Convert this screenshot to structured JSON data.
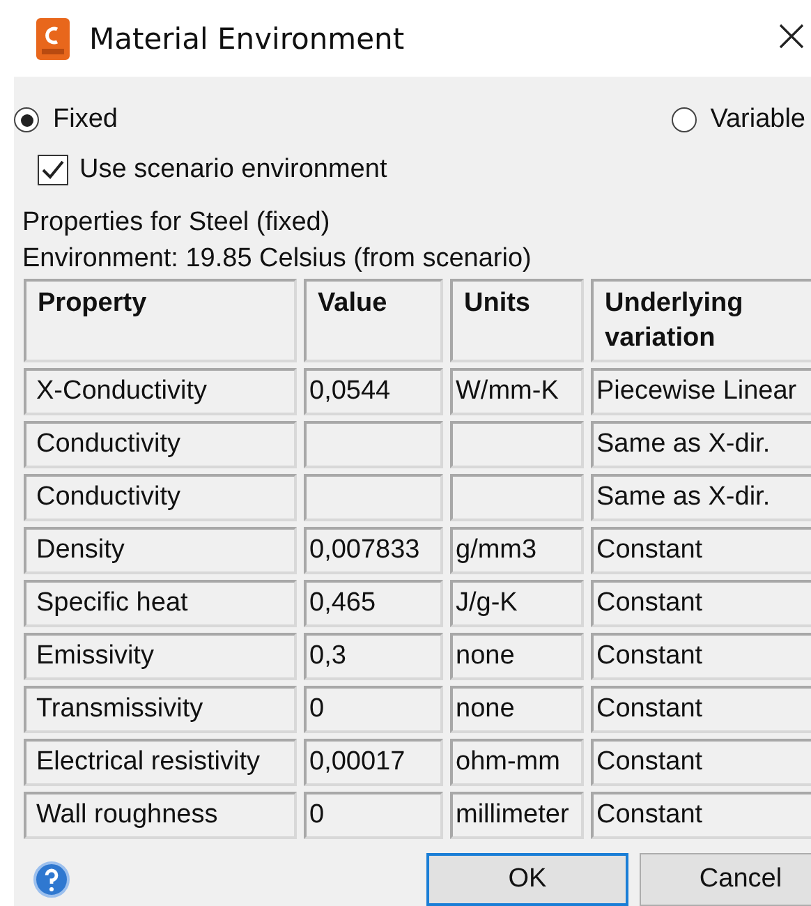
{
  "window": {
    "title": "Material Environment"
  },
  "modes": [
    {
      "label": "Fixed",
      "selected": true
    },
    {
      "label": "Variable",
      "selected": false
    }
  ],
  "scenario_checkbox": {
    "label": "Use scenario environment",
    "checked": true
  },
  "info": [
    "Properties for Steel (fixed)",
    "Environment: 19.85 Celsius (from scenario)"
  ],
  "table": {
    "columns": [
      "Property",
      "Value",
      "Units",
      "Underlying variation"
    ],
    "rows": [
      [
        "X-Conductivity",
        "0,0544",
        "W/mm-K",
        "Piecewise Linear"
      ],
      [
        "Conductivity",
        "",
        "",
        "Same as X-dir."
      ],
      [
        "Conductivity",
        "",
        "",
        "Same as X-dir."
      ],
      [
        "Density",
        "0,007833",
        "g/mm3",
        "Constant"
      ],
      [
        "Specific heat",
        "0,465",
        "J/g-K",
        "Constant"
      ],
      [
        "Emissivity",
        "0,3",
        "none",
        "Constant"
      ],
      [
        "Transmissivity",
        "0",
        "none",
        "Constant"
      ],
      [
        "Electrical resistivity",
        "0,00017",
        "ohm-mm",
        "Constant"
      ],
      [
        "Wall roughness",
        "0",
        "millimeter",
        "Constant"
      ]
    ]
  },
  "buttons": [
    {
      "label": "OK",
      "default": true
    },
    {
      "label": "Cancel",
      "default": false
    }
  ]
}
